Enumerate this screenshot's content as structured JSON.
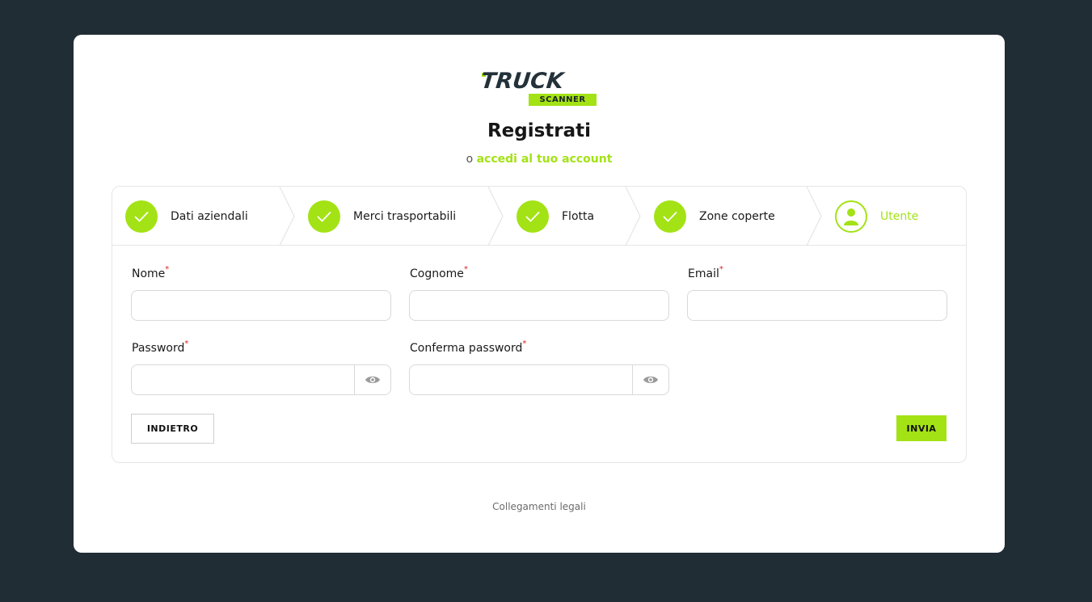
{
  "brand": {
    "logo_main": "TRUCK",
    "logo_sub": "SCANNER",
    "accent": "#a3e215"
  },
  "header": {
    "title": "Registrati",
    "prefix": "o",
    "login_link": "accedi al tuo account"
  },
  "steps": [
    {
      "label": "Dati aziendali",
      "status": "done",
      "icon": "check-icon"
    },
    {
      "label": "Merci trasportabili",
      "status": "done",
      "icon": "check-icon"
    },
    {
      "label": "Flotta",
      "status": "done",
      "icon": "check-icon"
    },
    {
      "label": "Zone coperte",
      "status": "done",
      "icon": "check-icon"
    },
    {
      "label": "Utente",
      "status": "active",
      "icon": "user-icon"
    }
  ],
  "form": {
    "nome_label": "Nome",
    "cognome_label": "Cognome",
    "email_label": "Email",
    "password_label": "Password",
    "confirm_label": "Conferma password",
    "required_mark": "*"
  },
  "actions": {
    "back_label": "INDIETRO",
    "submit_label": "INVIA"
  },
  "footer": {
    "legal_link": "Collegamenti legali"
  }
}
